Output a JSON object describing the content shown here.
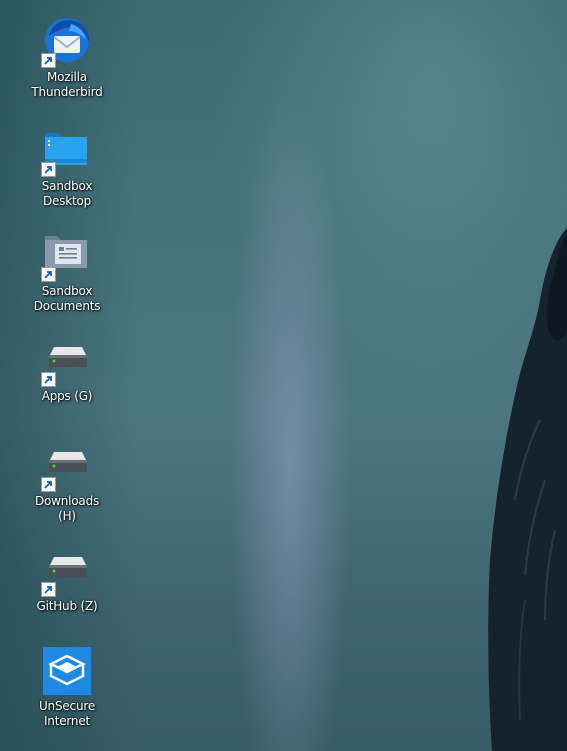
{
  "desktop": {
    "icons": [
      {
        "label": "Mozilla\nThunderbird",
        "icon": "thunderbird-icon",
        "shortcut": true
      },
      {
        "label": "Sandbox\nDesktop",
        "icon": "folder-desktop-icon",
        "shortcut": true
      },
      {
        "label": "Sandbox\nDocuments",
        "icon": "folder-documents-icon",
        "shortcut": true
      },
      {
        "label": "Apps (G)",
        "icon": "network-drive-icon",
        "shortcut": true
      },
      {
        "label": "Downloads\n(H)",
        "icon": "network-drive-icon",
        "shortcut": true
      },
      {
        "label": "GitHub (Z)",
        "icon": "network-drive-icon",
        "shortcut": true
      },
      {
        "label": "UnSecure\nInternet",
        "icon": "sandbox-app-icon",
        "shortcut": false
      }
    ]
  },
  "colors": {
    "wallpaper_base": "#46727a",
    "label_text": "#ffffff",
    "app_blue": "#1e88e5"
  }
}
